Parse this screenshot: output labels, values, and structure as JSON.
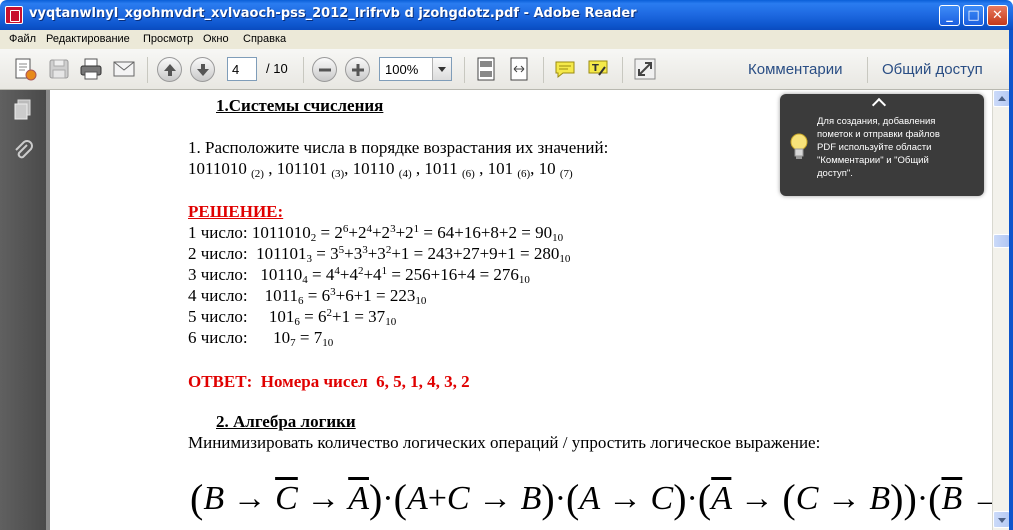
{
  "window": {
    "title": "vyqtanwlnyl_xgohmvdrt_xvlvaoch-pss_2012_lrifrvb d jzohgdotz.pdf - Adobe Reader",
    "min": "_",
    "max": "□",
    "close": "✕"
  },
  "menu": [
    "Файл",
    "Редактирование",
    "Просмотр",
    "Окно",
    "Справка"
  ],
  "toolbar": {
    "page_current": "4",
    "page_total": "/ 10",
    "zoom": "100%",
    "comments": "Комментарии",
    "share": "Общий доступ"
  },
  "tooltip": {
    "text": "Для создания, добавления\nпометок и отправки файлов\nPDF используйте области\n\"Комментарии\" и \"Общий\nдоступ\"."
  },
  "doc": {
    "heading1": "1.Системы счисления",
    "task1": "1. Расположите числа в порядке возрастания их значений:",
    "numbers": {
      "n1": "1011010",
      "b1": "(2)",
      "n2": "101101",
      "b2": "(3)",
      "n3": "10110",
      "b3": "(4)",
      "n4": "1011",
      "b4": "(6)",
      "n5": "101",
      "b5": "(6)",
      "n6": "10",
      "b6": "(7)"
    },
    "solution_label": "РЕШЕНИЕ:",
    "solution": {
      "l1": {
        "label": "1 число: ",
        "num": "1011010",
        "base": "2",
        "expr_a": " = 2",
        "p1": "6",
        "plus1": "+2",
        "p2": "4",
        "plus2": "+2",
        "p3": "3",
        "plus3": "+2",
        "p4": "1",
        "rest": " = 64+16+8+2 = 90",
        "res_base": "10"
      },
      "l2": {
        "label": "2 число:  ",
        "num": "101101",
        "base": "3",
        "expr_a": " = 3",
        "p1": "5",
        "plus1": "+3",
        "p2": "3",
        "plus2": "+3",
        "p3": "2",
        "rest": "+1 = 243+27+9+1 = 280",
        "res_base": "10"
      },
      "l3": {
        "label": "3 число:   ",
        "num": "10110",
        "base": "4",
        "expr_a": " = 4",
        "p1": "4",
        "plus1": "+4",
        "p2": "2",
        "plus2": "+4",
        "p3": "1",
        "rest": " = 256+16+4 = 276",
        "res_base": "10"
      },
      "l4": {
        "label": "4 число:    ",
        "num": "1011",
        "base": "6",
        "expr_a": " = 6",
        "p1": "3",
        "rest": "+6+1 = 223",
        "res_base": "10"
      },
      "l5": {
        "label": "5 число:     ",
        "num": "101",
        "base": "6",
        "expr_a": " = 6",
        "p1": "2",
        "rest": "+1 = 37",
        "res_base": "10"
      },
      "l6": {
        "label": "6 число:      ",
        "num": "10",
        "base": "7",
        "rest": " = 7",
        "res_base": "10"
      }
    },
    "answer": "ОТВЕТ:  Номера чисел  6, 5, 1, 4, 3, 2",
    "heading2": "2. Алгебра логики",
    "task2": "Минимизировать количество логических операций / упростить логическое выражение:"
  }
}
